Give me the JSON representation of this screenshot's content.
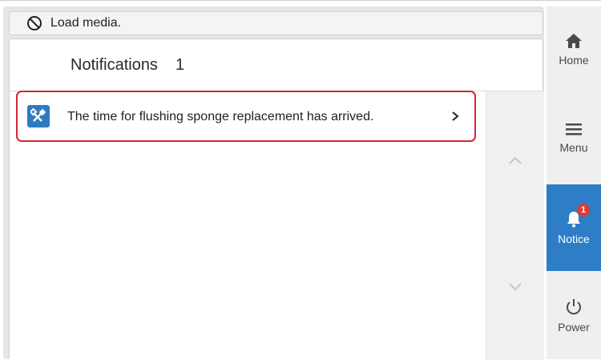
{
  "status_bar": {
    "icon": "no-symbol-icon",
    "message": "Load media."
  },
  "notifications": {
    "title": "Notifications",
    "count": "1",
    "items": [
      {
        "icon": "tools-icon",
        "text": "The time for flushing sponge replacement has arrived.",
        "chevron": "chevron-right-icon"
      }
    ]
  },
  "sidebar": {
    "items": [
      {
        "label": "Home",
        "icon": "home-icon"
      },
      {
        "label": "Menu",
        "icon": "hamburger-icon"
      },
      {
        "label": "Notice",
        "icon": "bell-icon",
        "badge": "1",
        "active": true
      },
      {
        "label": "Power",
        "icon": "power-icon"
      }
    ]
  },
  "colors": {
    "accent": "#2d7ec6",
    "highlight_border": "#d52433",
    "badge": "#e23a33"
  }
}
